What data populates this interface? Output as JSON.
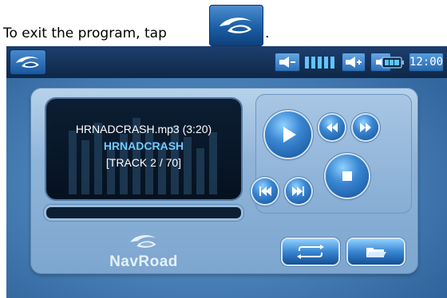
{
  "instruction": {
    "text": "To exit the program, tap",
    "icon": "navroad-logo-icon",
    "suffix": "."
  },
  "status_bar": {
    "icons": [
      "navroad-logo-icon",
      "volume-down-icon",
      "volume-level-icon",
      "volume-up-icon",
      "speaker-icon",
      "battery-icon"
    ],
    "volume_bars": 5,
    "time": "12:00"
  },
  "track": {
    "filename_line": "HRNADCRASH.mp3 (3:20)",
    "title": "HRNADCRASH",
    "track_line": "[TRACK 2 / 70]"
  },
  "playback": {
    "progress_fraction": 0.0
  },
  "controls": {
    "play": "play-icon",
    "rewind": "rewind-icon",
    "fast_forward": "fast-forward-icon",
    "previous": "previous-track-icon",
    "next": "next-track-icon",
    "stop": "stop-icon",
    "repeat": "repeat-icon",
    "open_folder": "folder-icon"
  },
  "brand": {
    "name": "NavRoad"
  },
  "colors": {
    "accent": "#2a6db4",
    "title_highlight": "#6fcaff",
    "display_bg": "#06111f"
  }
}
